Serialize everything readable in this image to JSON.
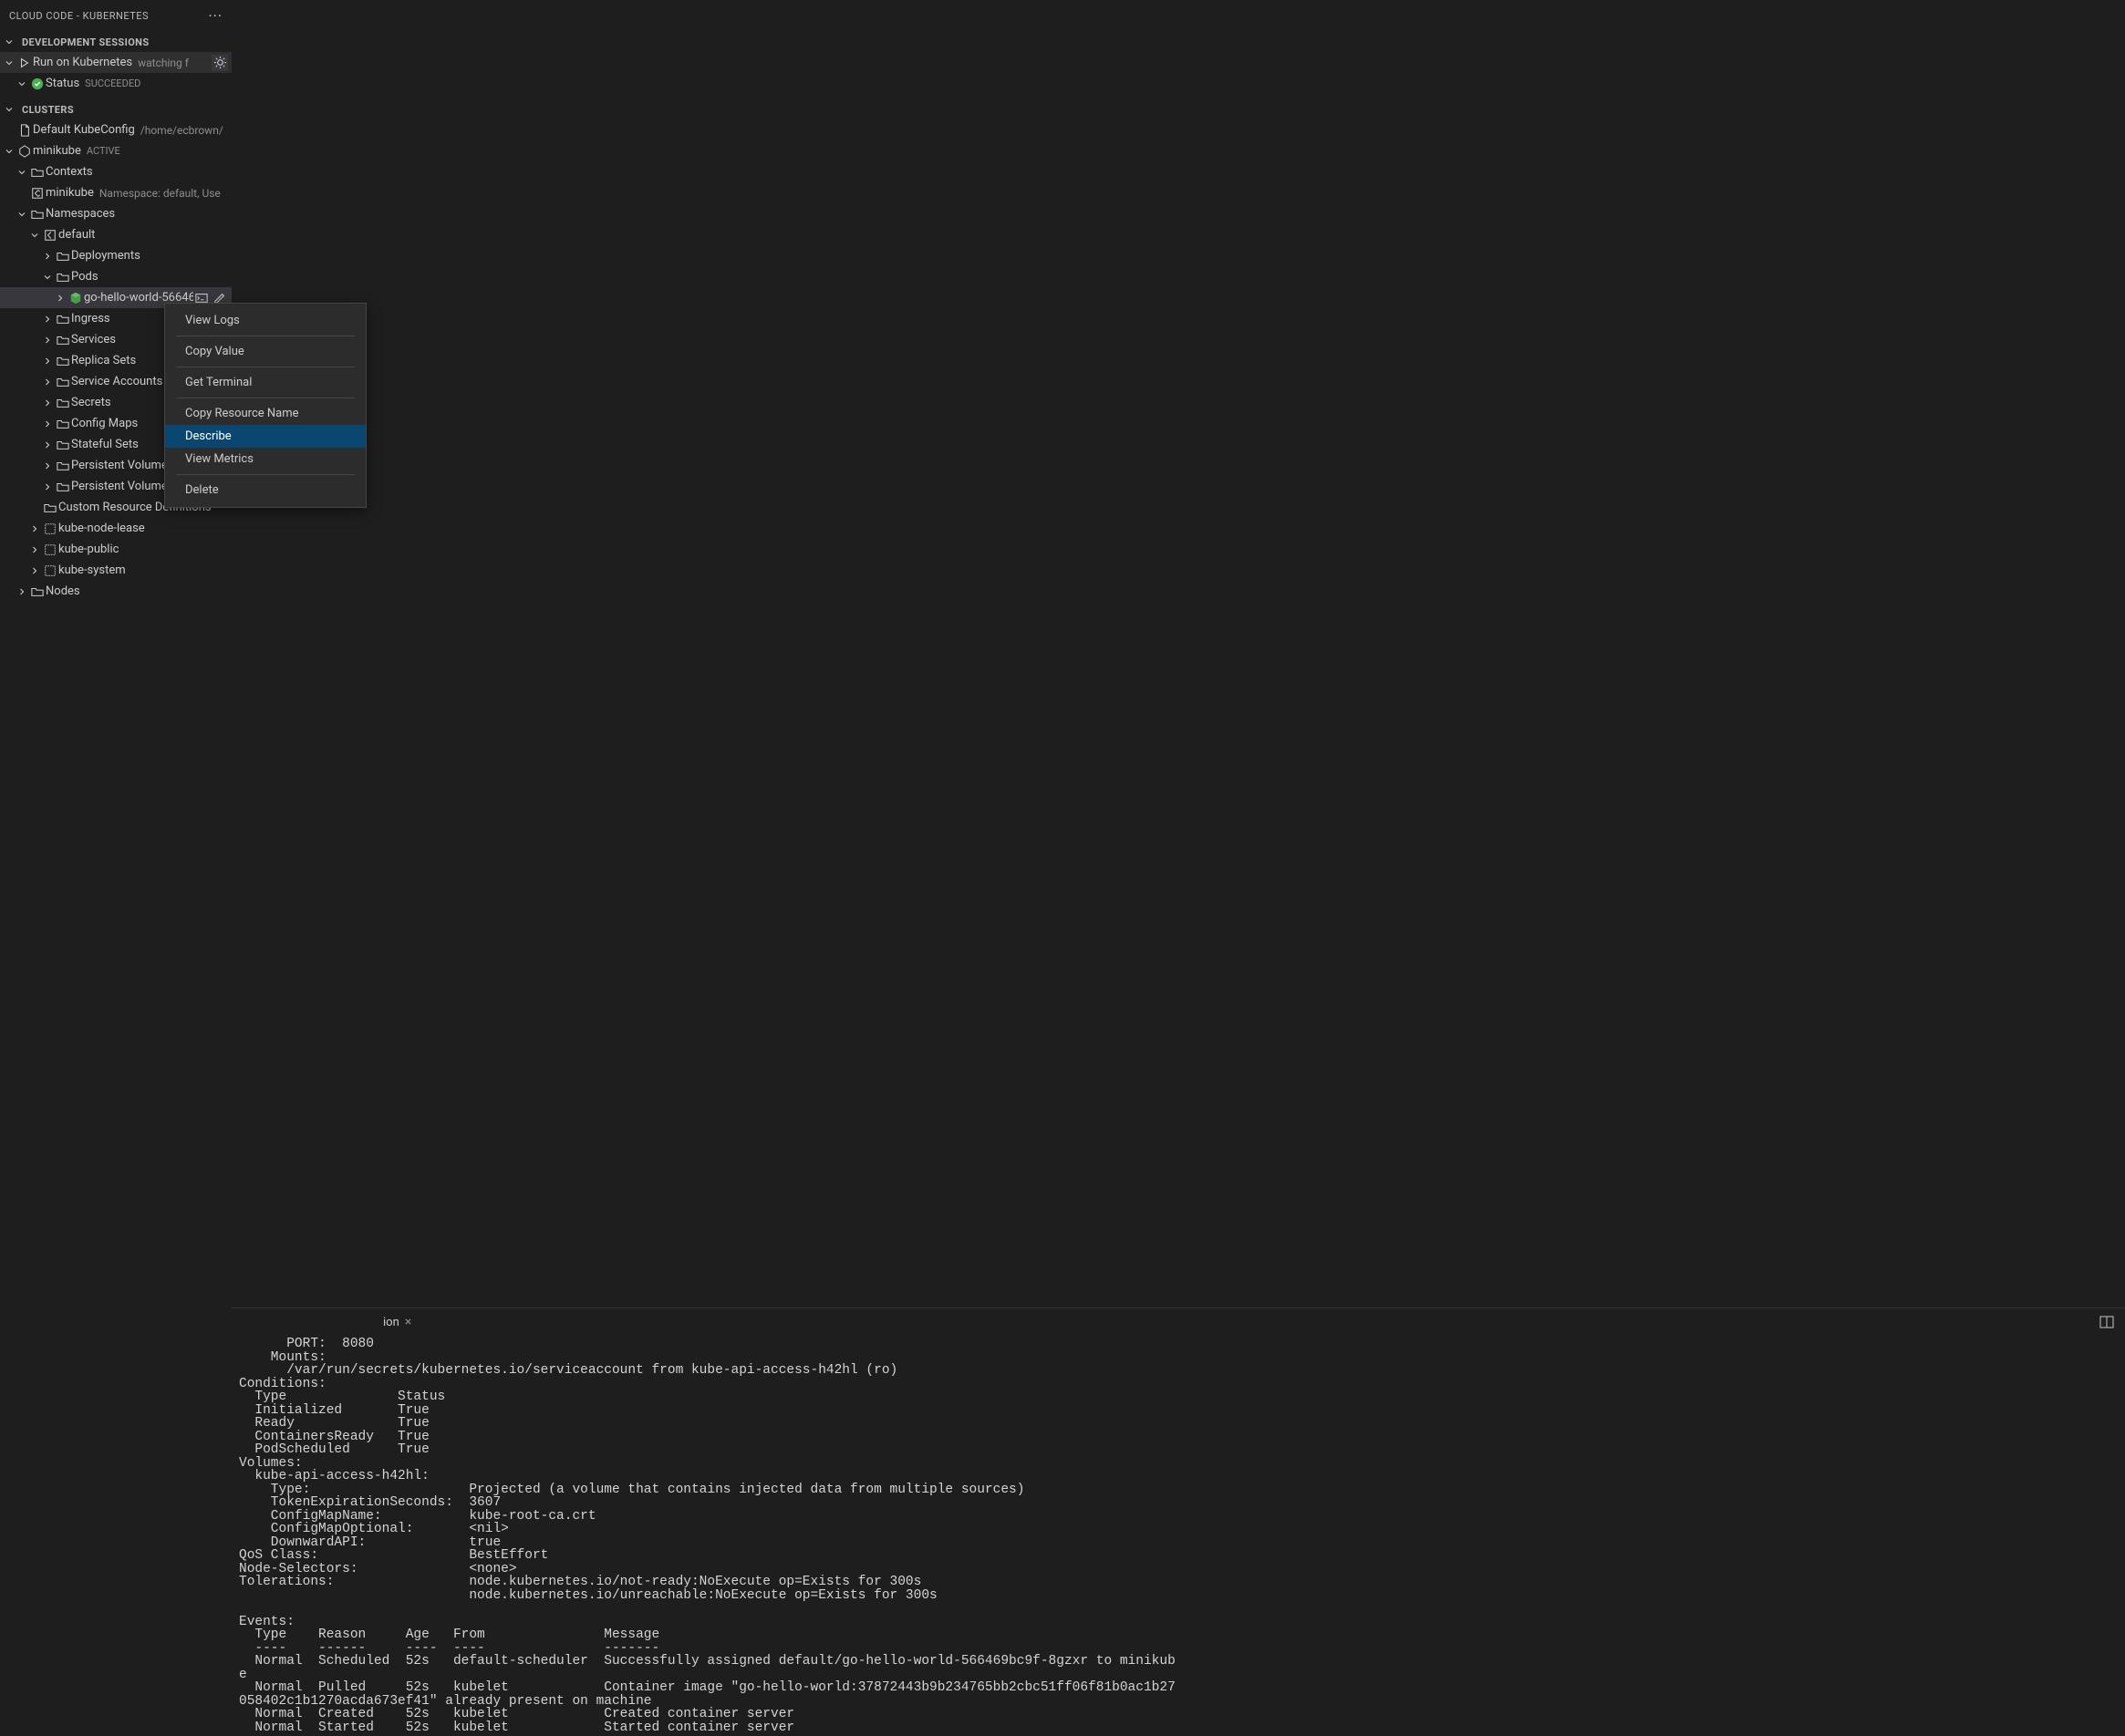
{
  "sidebar": {
    "title": "CLOUD CODE - KUBERNETES",
    "more_icon": "···"
  },
  "sections": {
    "dev_sessions": "DEVELOPMENT SESSIONS",
    "clusters": "CLUSTERS"
  },
  "dev_sessions": {
    "run_label": "Run on Kubernetes",
    "run_desc": "watching f",
    "status_label": "Status",
    "status_value": "SUCCEEDED"
  },
  "clusters": {
    "default_kubeconfig": "Default KubeConfig",
    "default_kubeconfig_path": "/home/ecbrown/",
    "minikube": "minikube",
    "minikube_badge": "ACTIVE",
    "contexts": "Contexts",
    "context_item": "minikube",
    "context_item_desc": "Namespace: default, Use",
    "namespaces": "Namespaces",
    "ns_default": "default",
    "deployments": "Deployments",
    "pods": "Pods",
    "pod_item": "go-hello-world-56646",
    "ingress": "Ingress",
    "services": "Services",
    "replica_sets": "Replica Sets",
    "service_accounts": "Service Accounts",
    "secrets": "Secrets",
    "config_maps": "Config Maps",
    "stateful_sets": "Stateful Sets",
    "pv": "Persistent Volumes",
    "pvc": "Persistent Volume",
    "crd": "Custom Resource Definitions",
    "ns_node_lease": "kube-node-lease",
    "ns_public": "kube-public",
    "ns_system": "kube-system",
    "nodes": "Nodes"
  },
  "context_menu": {
    "view_logs": "View Logs",
    "copy_value": "Copy Value",
    "get_terminal": "Get Terminal",
    "copy_resource_name": "Copy Resource Name",
    "describe": "Describe",
    "view_metrics": "View Metrics",
    "delete": "Delete"
  },
  "panel": {
    "tab_label_suffix": "ion",
    "close": "×"
  },
  "describe_output": "      PORT:  8080\n    Mounts:\n      /var/run/secrets/kubernetes.io/serviceaccount from kube-api-access-h42hl (ro)\nConditions:\n  Type              Status\n  Initialized       True\n  Ready             True\n  ContainersReady   True\n  PodScheduled      True\nVolumes:\n  kube-api-access-h42hl:\n    Type:                    Projected (a volume that contains injected data from multiple sources)\n    TokenExpirationSeconds:  3607\n    ConfigMapName:           kube-root-ca.crt\n    ConfigMapOptional:       <nil>\n    DownwardAPI:             true\nQoS Class:                   BestEffort\nNode-Selectors:              <none>\nTolerations:                 node.kubernetes.io/not-ready:NoExecute op=Exists for 300s\n                             node.kubernetes.io/unreachable:NoExecute op=Exists for 300s\n\nEvents:\n  Type    Reason     Age   From               Message\n  ----    ------     ----  ----               -------\n  Normal  Scheduled  52s   default-scheduler  Successfully assigned default/go-hello-world-566469bc9f-8gzxr to minikub\ne\n  Normal  Pulled     52s   kubelet            Container image \"go-hello-world:37872443b9b234765bb2cbc51ff06f81b0ac1b27\n058402c1b1270acda673ef41\" already present on machine\n  Normal  Created    52s   kubelet            Created container server\n  Normal  Started    52s   kubelet            Started container server"
}
